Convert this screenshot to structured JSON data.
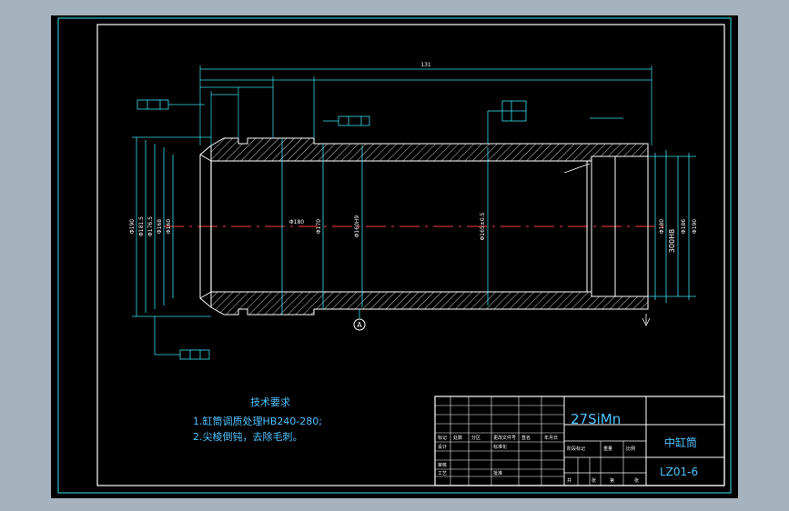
{
  "drawing": {
    "material": "27SiMn",
    "part_name": "中缸筒",
    "drawing_number": "LZ01-6",
    "overall_length_dim": "131",
    "tech_requirements": {
      "title": "技术要求",
      "items": [
        "1.缸筒调质处理HB240-280;",
        "2.尖棱倒钝，去除毛刺。"
      ]
    },
    "section_marker": "A",
    "title_block": {
      "row_labels": [
        "标记",
        "处数",
        "分区",
        "更改文件号",
        "签名",
        "年月日"
      ],
      "design_labels": [
        "设计",
        "标准化"
      ],
      "stage_labels": [
        "阶段标记",
        "重量",
        "比例"
      ],
      "approve_labels": [
        "审核",
        "工艺",
        "批准"
      ],
      "sheet_labels": [
        "共",
        "张",
        "第",
        "张"
      ]
    },
    "dimensions": {
      "left_diameters": [
        "Φ190",
        "Φ181.5",
        "Φ176.5",
        "Φ168",
        "Φ160"
      ],
      "mid_diameters": [
        "Φ180",
        "Φ170",
        "Φ160H9",
        "Φ165±0.5"
      ],
      "right_diameters": [
        "300H8",
        "Φ180",
        "Φ186",
        "Φ190"
      ]
    },
    "colors": {
      "background": "#000000",
      "frame": "#39e2f2",
      "geometry": "#ffffff",
      "centerline": "#ff3b3b"
    }
  }
}
